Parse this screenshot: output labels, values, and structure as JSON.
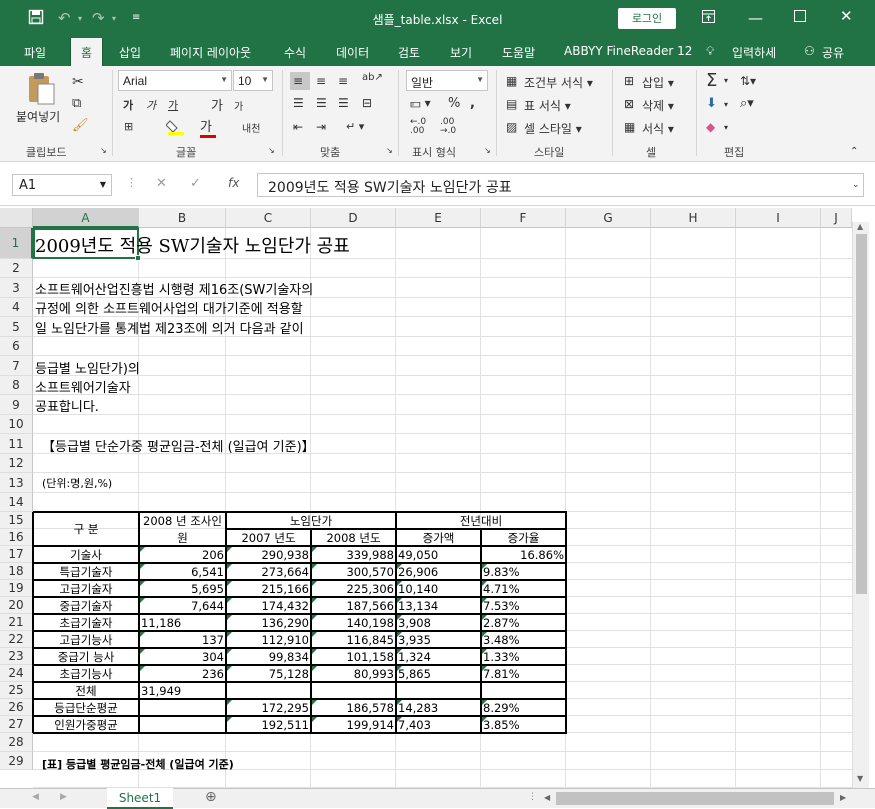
{
  "window": {
    "title": "샘플_table.xlsx  -  Excel",
    "login": "로그인",
    "icons": [
      "save-icon",
      "undo-icon",
      "redo-icon",
      "customize-icon"
    ]
  },
  "tabs": [
    "파일",
    "홈",
    "삽입",
    "페이지 레이아웃",
    "수식",
    "데이터",
    "검토",
    "보기",
    "도움말",
    "ABBYY FineReader 12",
    "입력하세",
    "공유"
  ],
  "ribbon": {
    "paste": "붙여넣기",
    "font_name": "Arial",
    "font_size": "10",
    "number_format": "일반",
    "cond_format": "조건부 서식",
    "table_format": "표 서식",
    "cell_style": "셀 스타일",
    "insert": "삽입",
    "delete": "삭제",
    "format": "서식",
    "groups": [
      "클립보드",
      "글꼴",
      "맞춤",
      "표시 형식",
      "스타일",
      "셀",
      "편집"
    ],
    "font_buttons": [
      "가",
      "가",
      "가",
      "가",
      "가"
    ],
    "bold": "가",
    "italic": "가",
    "underline": "가",
    "grow": "가",
    "shrink": "가",
    "phonetic": "내천",
    "percent": "%"
  },
  "formula_bar": {
    "name_box": "A1",
    "content": "2009년도 적용 SW기술자 노임단가 공표"
  },
  "columns": [
    "A",
    "B",
    "C",
    "D",
    "E",
    "F",
    "G",
    "H",
    "I",
    "J"
  ],
  "rows": [
    "1",
    "2",
    "3",
    "4",
    "5",
    "6",
    "7",
    "8",
    "9",
    "10",
    "11",
    "12",
    "13",
    "14",
    "15",
    "16",
    "17",
    "18",
    "19",
    "20",
    "21",
    "22",
    "23",
    "24",
    "25",
    "26",
    "27",
    "28",
    "29"
  ],
  "text_cells": {
    "r1": "2009년도 적용 SW기술자 노임단가 공표",
    "r3": "소프트웨어산업진흥법 시행령 제16조(SW기술자의",
    "r4": "규정에 의한 소프트웨어사업의 대가기준에 적용할",
    "r5": "일 노임단가를 통계법 제23조에 의거 다음과 같이",
    "r7": "등급별 노임단가)의",
    "r8": "소프트웨어기술자",
    "r9": "공표합니다.",
    "r11": "【등급별 단순가중 평균임금-전체 (일급여 기준)】",
    "r13": "(단위:명,원,%)",
    "r29": "[표] 등급별 평균임금-전체 (일급여 기준)"
  },
  "table": {
    "header": {
      "gubun": "구 분",
      "survey": "2008 년 조사인",
      "survey2": "원",
      "wage": "노임단가",
      "y2007": "2007 년도",
      "y2008": "2008 년도",
      "yoy": "전년대비",
      "inc_amt": "증가액",
      "inc_rate": "증가율"
    },
    "rows": [
      [
        "기술사",
        "206",
        "290,938",
        "339,988",
        "49,050",
        "16.86%"
      ],
      [
        "특급기술자",
        "6,541",
        "273,664",
        "300,570",
        "26,906",
        "9.83%"
      ],
      [
        "고급기술자",
        "5,695",
        "215,166",
        "225,306",
        "10,140",
        "4.71%"
      ],
      [
        "중급기술자",
        "7,644",
        "174,432",
        "187,566",
        "13,134",
        "7.53%"
      ],
      [
        "초급기술자",
        "11,186",
        "136,290",
        "140,198",
        "3,908",
        "2.87%"
      ],
      [
        "고급기능사",
        "137",
        "112,910",
        "116,845",
        "3,935",
        "3.48%"
      ],
      [
        "중급기 능사",
        "304",
        "99,834",
        "101,158",
        "1,324",
        "1.33%"
      ],
      [
        "초급기능사",
        "236",
        "75,128",
        "80,993",
        "5,865",
        "7.81%"
      ],
      [
        "전체",
        "31,949",
        "",
        "",
        "",
        ""
      ],
      [
        "등급단순평균",
        "",
        "172,295",
        "186,578",
        "14,283",
        "8.29%"
      ],
      [
        "인원가중평균",
        "",
        "192,511",
        "199,914",
        "7,403",
        "3.85%"
      ]
    ]
  },
  "sheet_tab": "Sheet1"
}
